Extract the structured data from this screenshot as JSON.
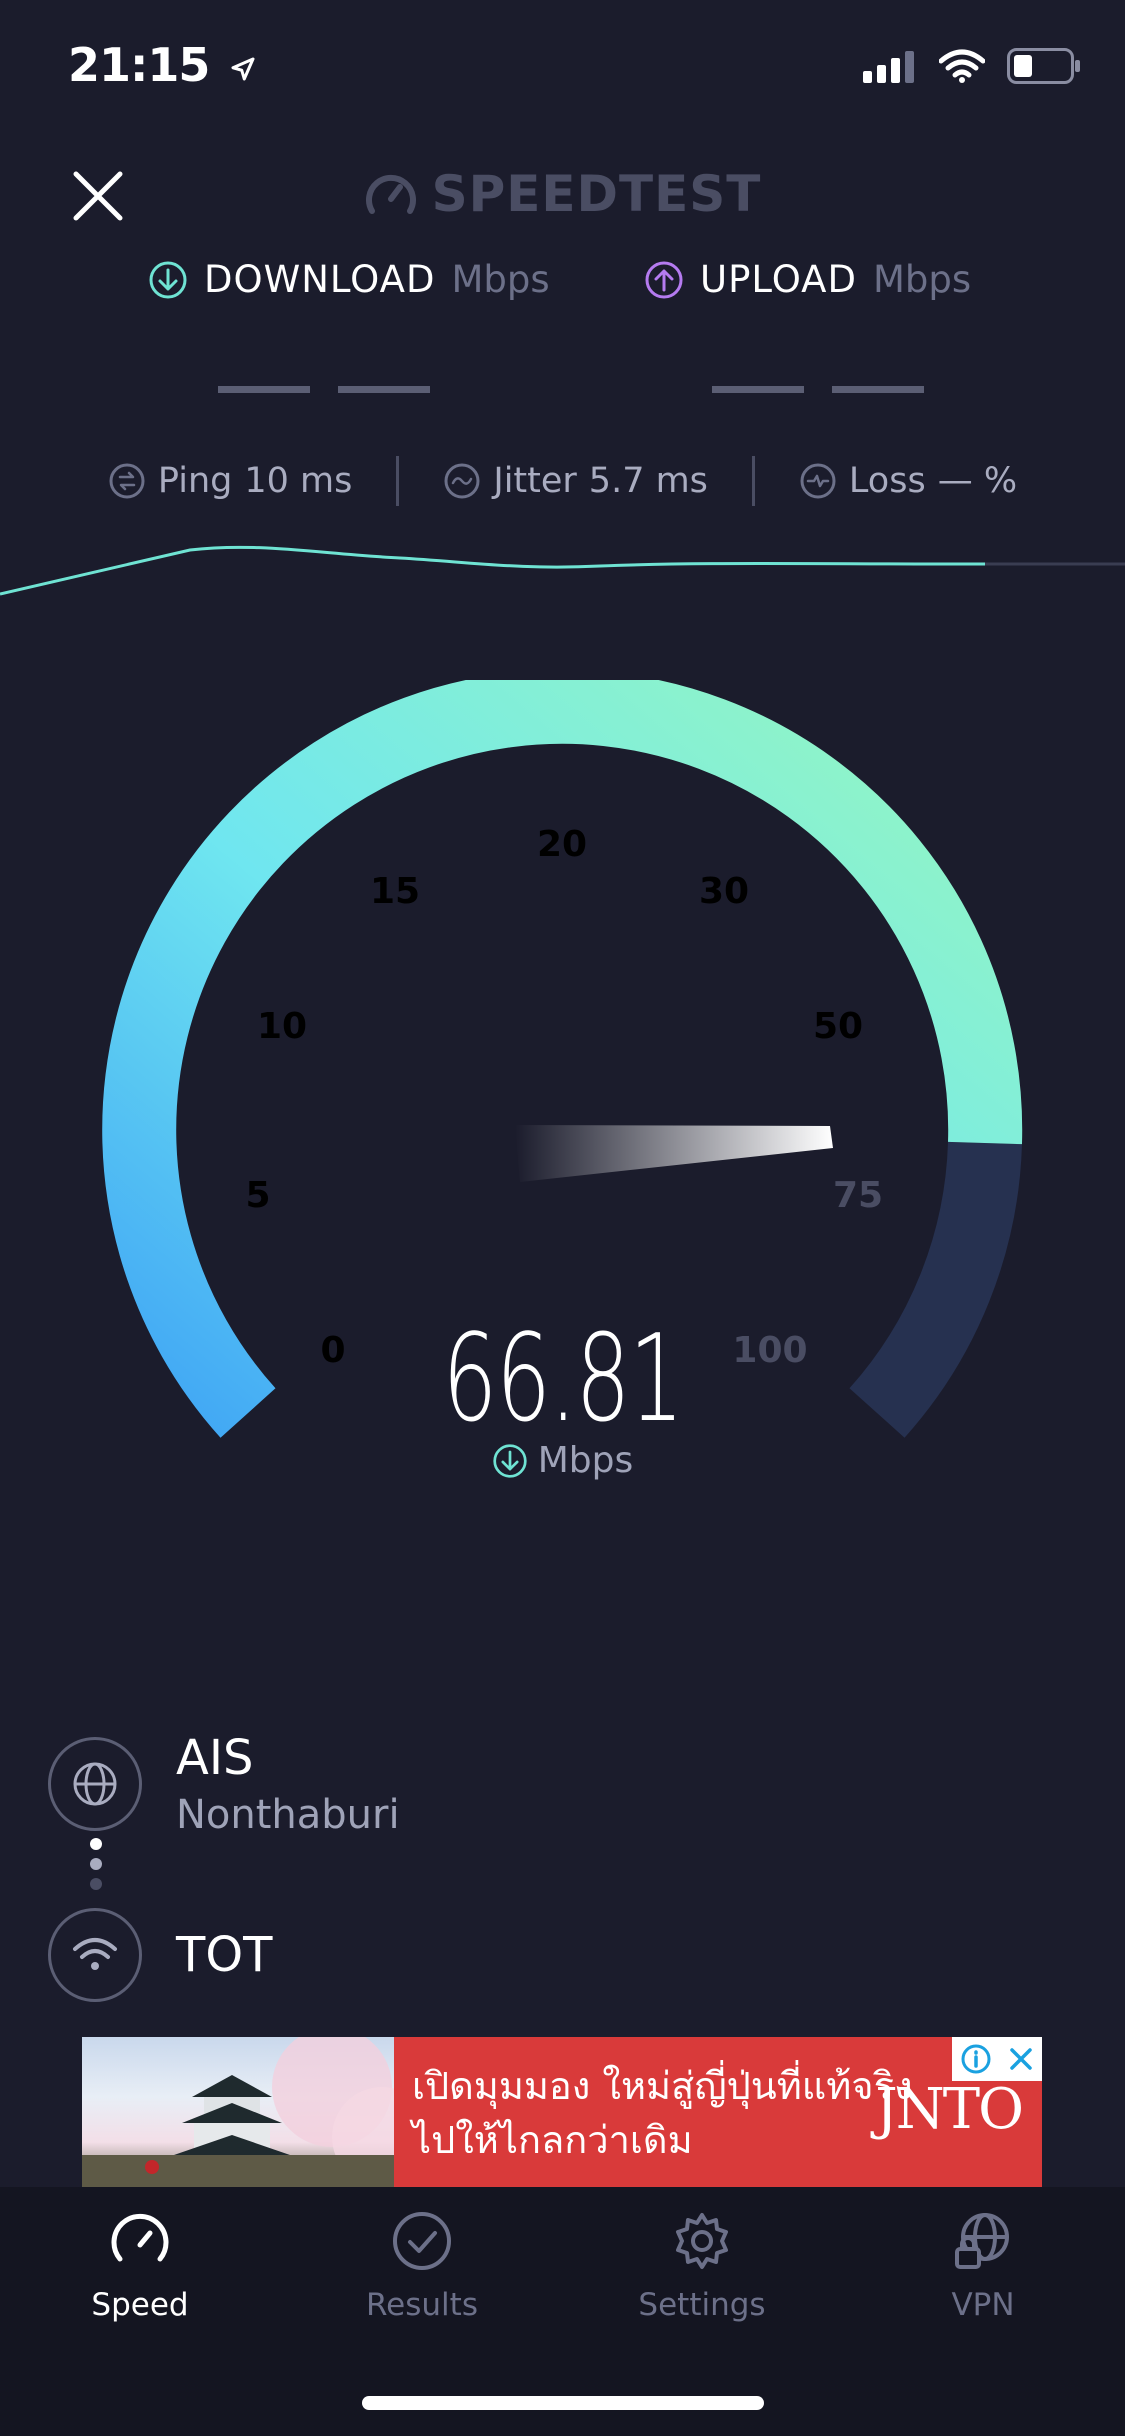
{
  "status_bar": {
    "time": "21:15"
  },
  "header": {
    "brand": "SPEEDTEST"
  },
  "download": {
    "label": "DOWNLOAD",
    "unit": "Mbps"
  },
  "upload": {
    "label": "UPLOAD",
    "unit": "Mbps"
  },
  "stats": {
    "ping_label": "Ping",
    "ping_value": "10 ms",
    "jitter_label": "Jitter",
    "jitter_value": "5.7 ms",
    "loss_label": "Loss",
    "loss_value": "— %"
  },
  "gauge": {
    "ticks": [
      "0",
      "5",
      "10",
      "15",
      "20",
      "30",
      "50",
      "75",
      "100"
    ],
    "value": "66.81",
    "unit": "Mbps"
  },
  "server": {
    "provider": "AIS",
    "location": "Nonthaburi",
    "isp": "TOT"
  },
  "ad": {
    "line1": "เปิดมุมมอง ใหม่สู่ญี่ปุ่นที่แท้จริง",
    "line2": "ไปให้ไกลกว่าเดิม",
    "brand": "JNTO"
  },
  "tabs": [
    {
      "label": "Speed",
      "icon": "speedometer-icon",
      "active": true
    },
    {
      "label": "Results",
      "icon": "checkmark-circle-icon",
      "active": false
    },
    {
      "label": "Settings",
      "icon": "gear-icon",
      "active": false
    },
    {
      "label": "VPN",
      "icon": "vpn-globe-lock-icon",
      "active": false
    }
  ],
  "colors": {
    "background": "#1b1c2c",
    "accent_download": "#6fe3d3",
    "accent_upload": "#b57bf0"
  }
}
